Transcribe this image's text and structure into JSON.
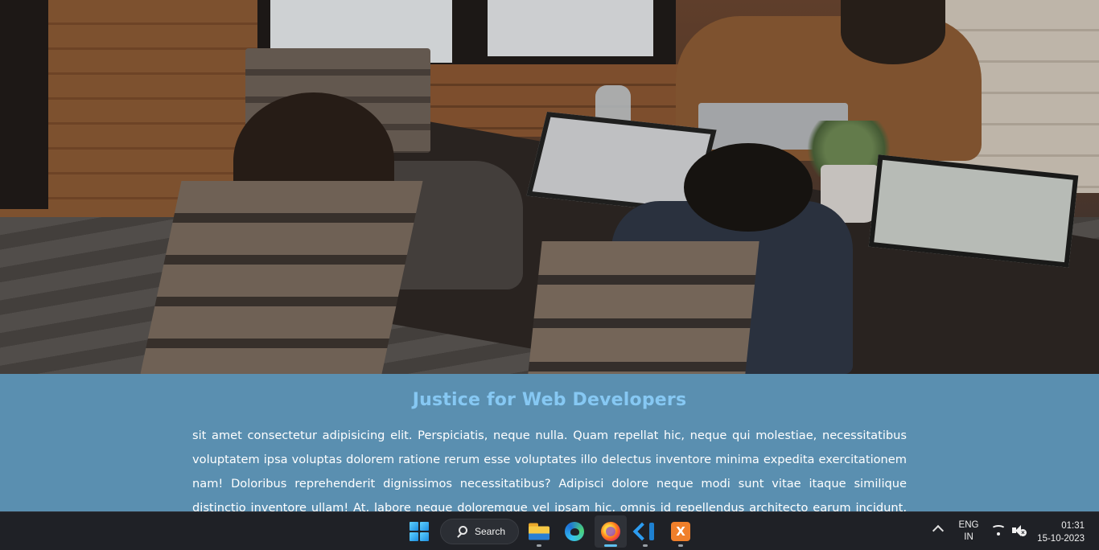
{
  "article": {
    "title": "Justice for Web Developers",
    "body": "sit amet consectetur adipisicing elit. Perspiciatis, neque nulla. Quam repellat hic, neque qui molestiae, necessitatibus voluptatem ipsa voluptas dolorem ratione rerum esse voluptates illo delectus inventore minima expedita exercitationem nam! Doloribus reprehenderit dignissimos necessitatibus? Adipisci dolore neque modi sunt vitae itaque similique distinctio inventore ullam! At, labore neque doloremque vel ipsam hic, omnis id repellendus architecto earum incidunt, explicabo"
  },
  "colors": {
    "section_bg": "#5a8fb0",
    "title": "#86c8f3",
    "body_text": "#ffffff",
    "taskbar_bg": "#1f2126"
  },
  "taskbar": {
    "search_label": "Search",
    "apps": [
      {
        "icon": "windows-start-icon",
        "running": false
      },
      {
        "icon": "file-explorer-icon",
        "running": true
      },
      {
        "icon": "edge-icon",
        "running": false
      },
      {
        "icon": "firefox-icon",
        "running": true,
        "active": true
      },
      {
        "icon": "vscode-icon",
        "running": true
      },
      {
        "icon": "xampp-icon",
        "running": true
      }
    ],
    "tray": {
      "lang_line1": "ENG",
      "lang_line2": "IN",
      "time": "01:31",
      "date": "15-10-2023"
    }
  }
}
